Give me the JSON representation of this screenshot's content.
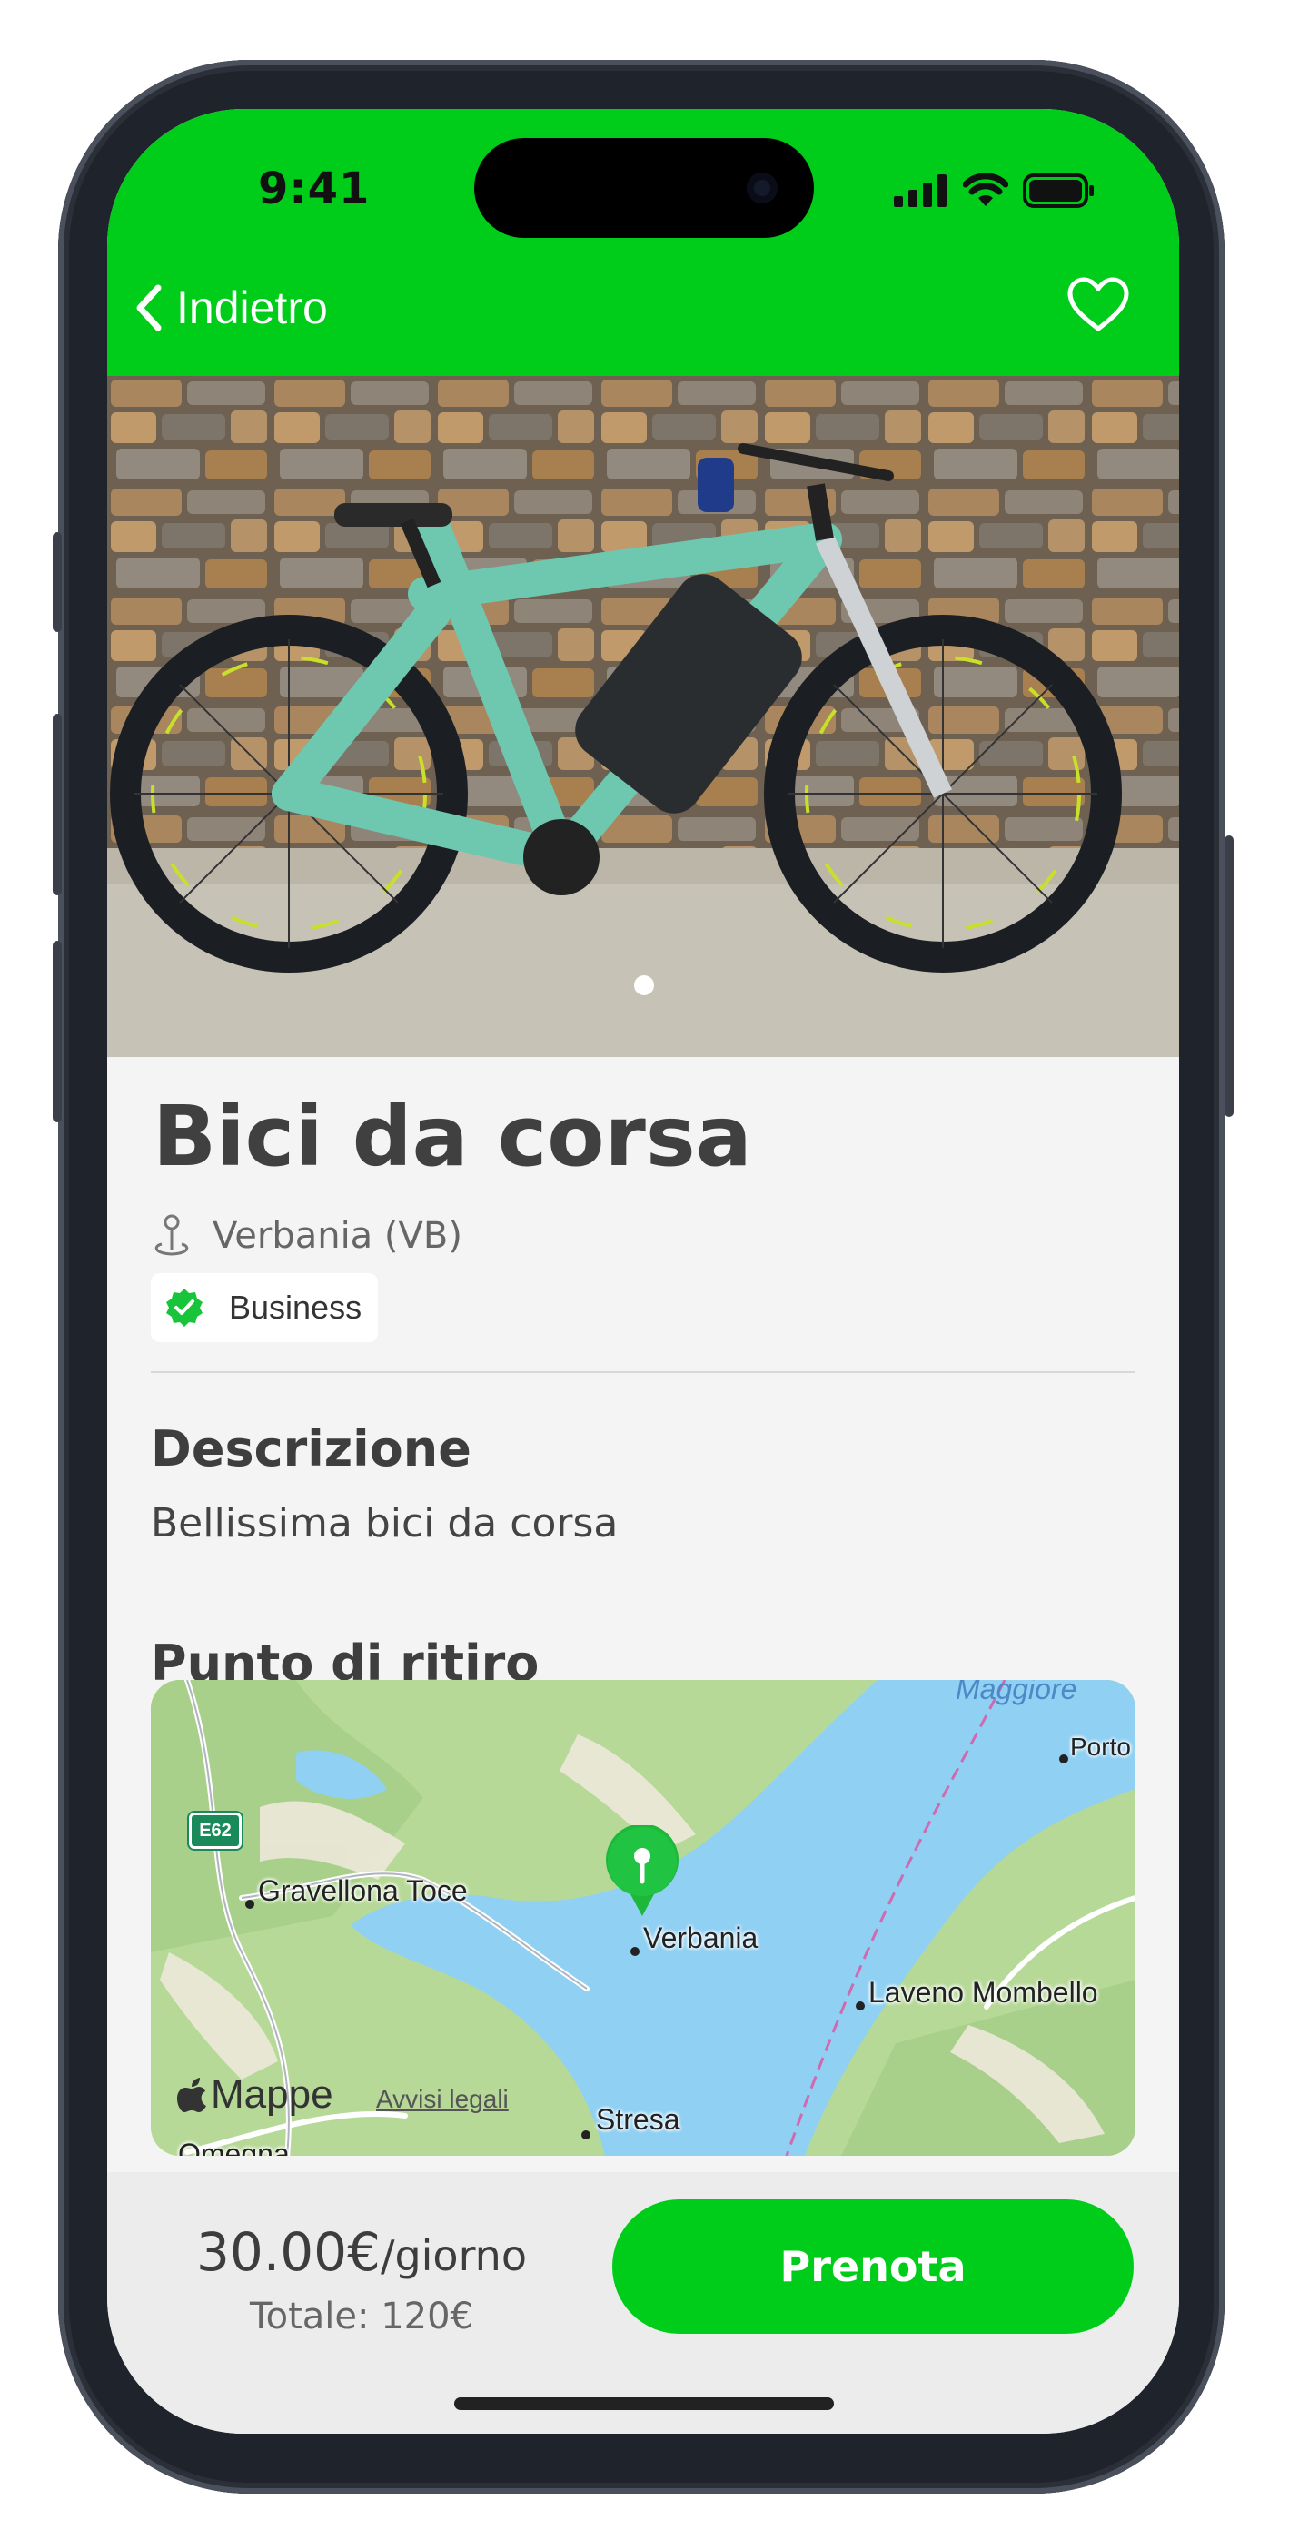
{
  "status_bar": {
    "time": "9:41"
  },
  "nav": {
    "back_label": "Indietro"
  },
  "colors": {
    "brand_green": "#00cc1a",
    "verified_green": "#17c43a"
  },
  "icons": [
    "chevron-left-icon",
    "heart-outline-icon",
    "location-pin-icon",
    "verified-check-icon",
    "map-pin-icon",
    "apple-logo-icon",
    "signal-icon",
    "wifi-icon",
    "battery-icon"
  ],
  "gallery": {
    "image_count": 1,
    "current_index": 1
  },
  "listing": {
    "title": "Bici da corsa",
    "location": "Verbania (VB)",
    "badge": "Business"
  },
  "description": {
    "heading": "Descrizione",
    "text": "Bellissima bici da corsa"
  },
  "pickup": {
    "heading": "Punto di ritiro",
    "map": {
      "brand": "Mappe",
      "legal": "Avvisi legali",
      "road_shield": "E62",
      "places": [
        "Gravellona Toce",
        "Verbania",
        "Laveno Mombello",
        "Stresa",
        "Porto",
        "Omegna"
      ],
      "lake_label": "Maggiore"
    }
  },
  "footer": {
    "price": "30.00€",
    "price_unit": "/giorno",
    "total": "Totale: 120€",
    "book_label": "Prenota"
  }
}
